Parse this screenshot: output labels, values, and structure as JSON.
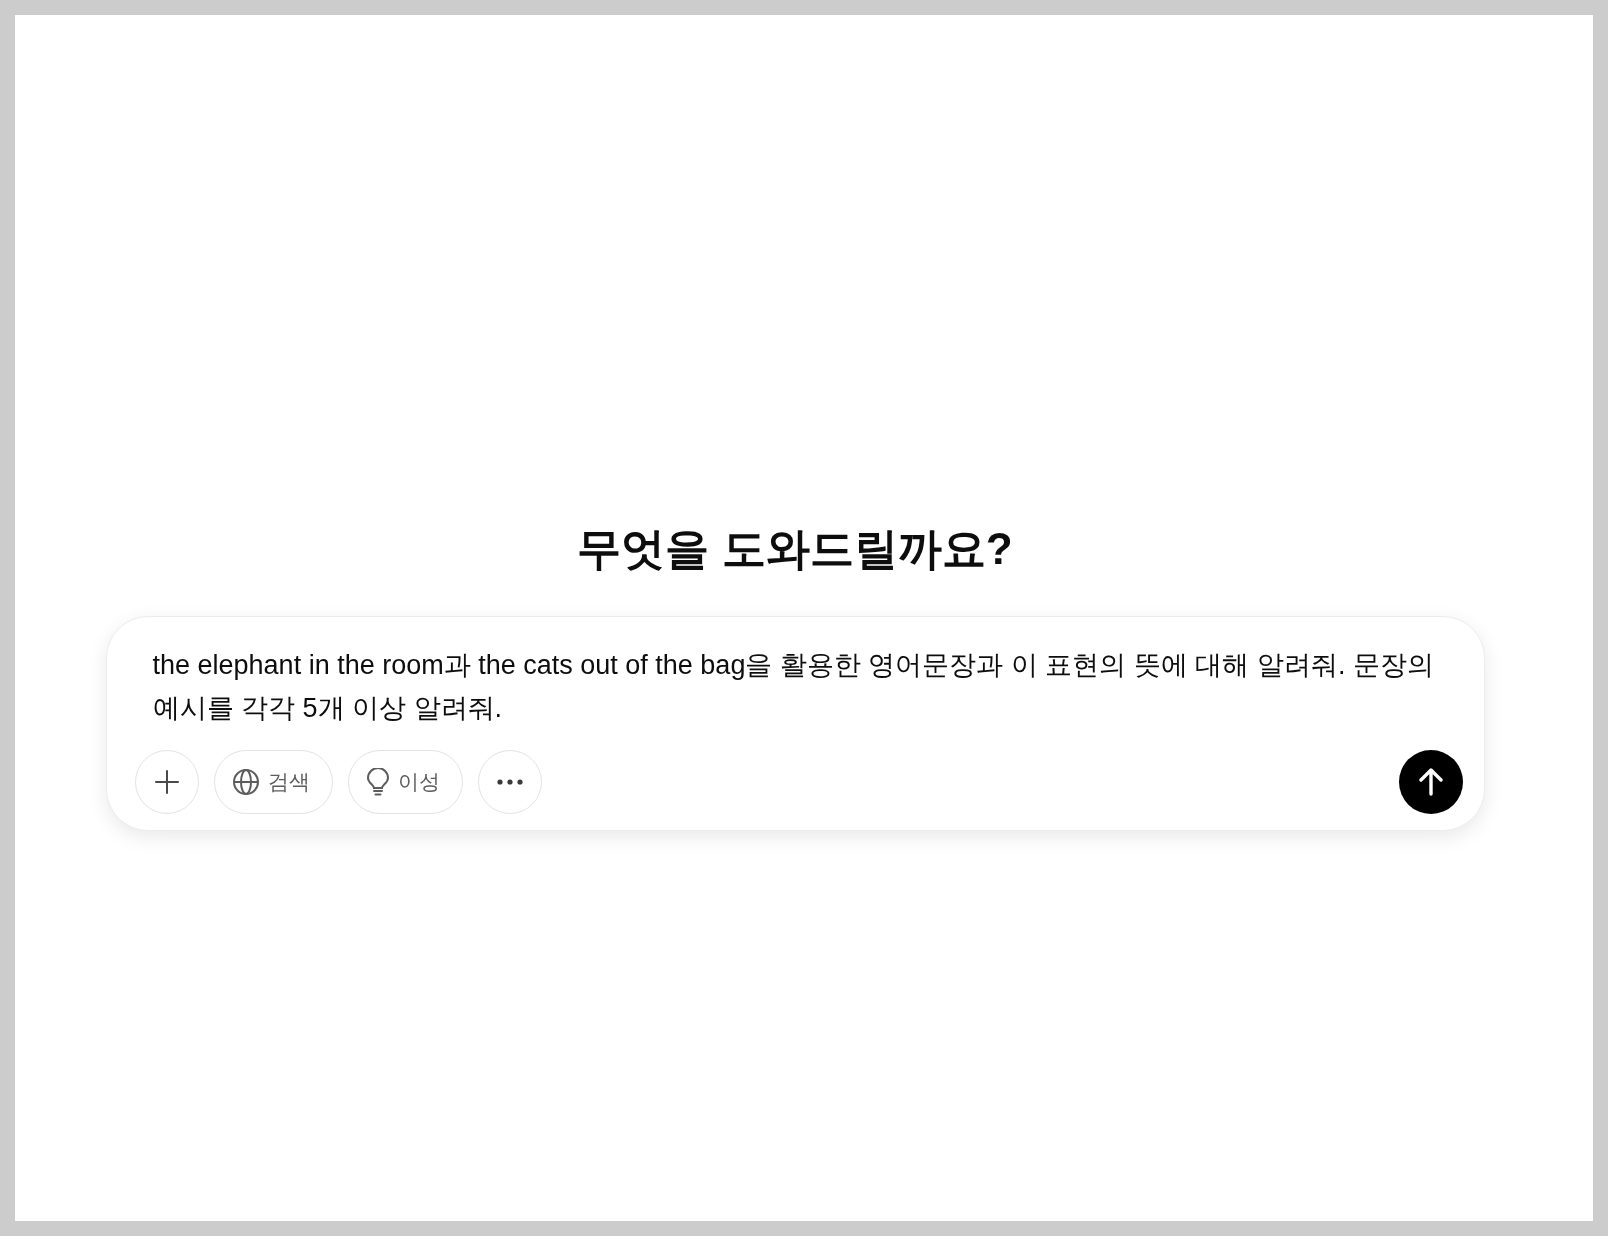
{
  "heading": "무엇을 도와드릴까요?",
  "composer": {
    "value": "the elephant in the room과 the cats out of the bag을 활용한 영어문장과 이 표현의 뜻에 대해 알려줘. 문장의 예시를 각각 5개 이상 알려줘.",
    "tools": [
      {
        "label": "검색",
        "selected": false
      },
      {
        "label": "이성",
        "selected": false
      }
    ]
  }
}
